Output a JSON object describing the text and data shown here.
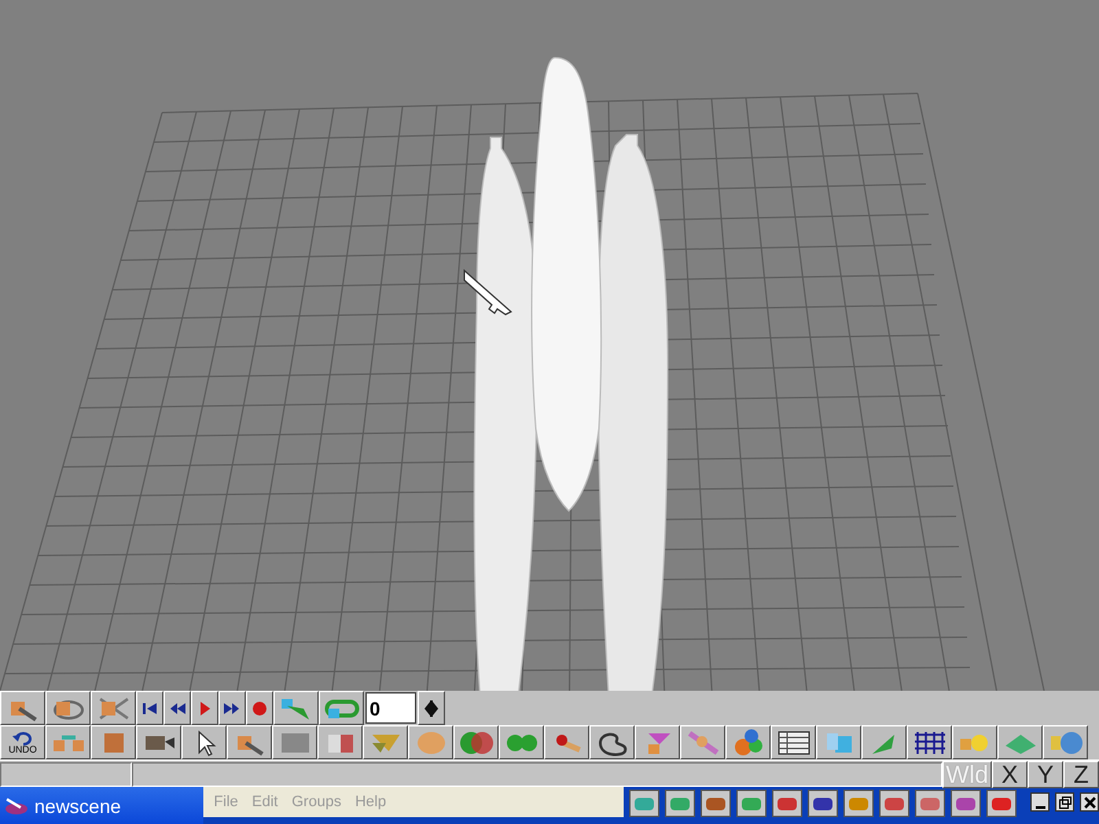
{
  "toolbar": {
    "frame_field": {
      "value": "0"
    },
    "undo_label": "UNDO"
  },
  "axis_buttons": [
    {
      "label": "Wld",
      "disabled": true
    },
    {
      "label": "X",
      "disabled": false
    },
    {
      "label": "Y",
      "disabled": false
    },
    {
      "label": "Z",
      "disabled": false
    }
  ],
  "window": {
    "title": "newscene"
  },
  "menu": [
    {
      "label": "File",
      "disabled": true
    },
    {
      "label": "Edit",
      "disabled": true
    },
    {
      "label": "Groups",
      "disabled": true
    },
    {
      "label": "Help",
      "disabled": true
    }
  ]
}
